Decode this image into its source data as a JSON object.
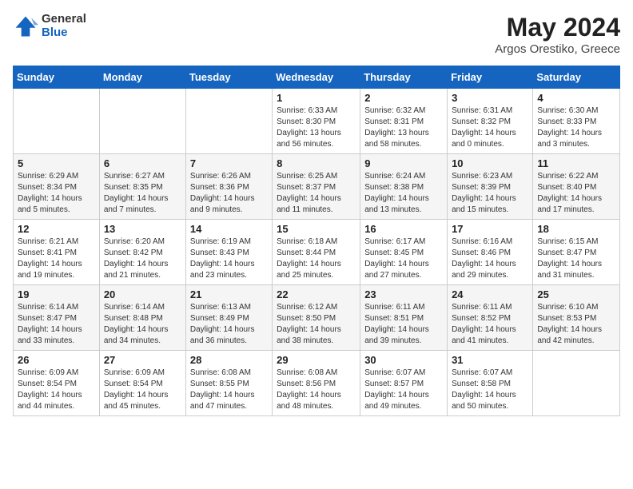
{
  "header": {
    "logo_general": "General",
    "logo_blue": "Blue",
    "month_title": "May 2024",
    "location": "Argos Orestiko, Greece"
  },
  "days_of_week": [
    "Sunday",
    "Monday",
    "Tuesday",
    "Wednesday",
    "Thursday",
    "Friday",
    "Saturday"
  ],
  "weeks": [
    [
      {
        "day": "",
        "info": ""
      },
      {
        "day": "",
        "info": ""
      },
      {
        "day": "",
        "info": ""
      },
      {
        "day": "1",
        "info": "Sunrise: 6:33 AM\nSunset: 8:30 PM\nDaylight: 13 hours\nand 56 minutes."
      },
      {
        "day": "2",
        "info": "Sunrise: 6:32 AM\nSunset: 8:31 PM\nDaylight: 13 hours\nand 58 minutes."
      },
      {
        "day": "3",
        "info": "Sunrise: 6:31 AM\nSunset: 8:32 PM\nDaylight: 14 hours\nand 0 minutes."
      },
      {
        "day": "4",
        "info": "Sunrise: 6:30 AM\nSunset: 8:33 PM\nDaylight: 14 hours\nand 3 minutes."
      }
    ],
    [
      {
        "day": "5",
        "info": "Sunrise: 6:29 AM\nSunset: 8:34 PM\nDaylight: 14 hours\nand 5 minutes."
      },
      {
        "day": "6",
        "info": "Sunrise: 6:27 AM\nSunset: 8:35 PM\nDaylight: 14 hours\nand 7 minutes."
      },
      {
        "day": "7",
        "info": "Sunrise: 6:26 AM\nSunset: 8:36 PM\nDaylight: 14 hours\nand 9 minutes."
      },
      {
        "day": "8",
        "info": "Sunrise: 6:25 AM\nSunset: 8:37 PM\nDaylight: 14 hours\nand 11 minutes."
      },
      {
        "day": "9",
        "info": "Sunrise: 6:24 AM\nSunset: 8:38 PM\nDaylight: 14 hours\nand 13 minutes."
      },
      {
        "day": "10",
        "info": "Sunrise: 6:23 AM\nSunset: 8:39 PM\nDaylight: 14 hours\nand 15 minutes."
      },
      {
        "day": "11",
        "info": "Sunrise: 6:22 AM\nSunset: 8:40 PM\nDaylight: 14 hours\nand 17 minutes."
      }
    ],
    [
      {
        "day": "12",
        "info": "Sunrise: 6:21 AM\nSunset: 8:41 PM\nDaylight: 14 hours\nand 19 minutes."
      },
      {
        "day": "13",
        "info": "Sunrise: 6:20 AM\nSunset: 8:42 PM\nDaylight: 14 hours\nand 21 minutes."
      },
      {
        "day": "14",
        "info": "Sunrise: 6:19 AM\nSunset: 8:43 PM\nDaylight: 14 hours\nand 23 minutes."
      },
      {
        "day": "15",
        "info": "Sunrise: 6:18 AM\nSunset: 8:44 PM\nDaylight: 14 hours\nand 25 minutes."
      },
      {
        "day": "16",
        "info": "Sunrise: 6:17 AM\nSunset: 8:45 PM\nDaylight: 14 hours\nand 27 minutes."
      },
      {
        "day": "17",
        "info": "Sunrise: 6:16 AM\nSunset: 8:46 PM\nDaylight: 14 hours\nand 29 minutes."
      },
      {
        "day": "18",
        "info": "Sunrise: 6:15 AM\nSunset: 8:47 PM\nDaylight: 14 hours\nand 31 minutes."
      }
    ],
    [
      {
        "day": "19",
        "info": "Sunrise: 6:14 AM\nSunset: 8:47 PM\nDaylight: 14 hours\nand 33 minutes."
      },
      {
        "day": "20",
        "info": "Sunrise: 6:14 AM\nSunset: 8:48 PM\nDaylight: 14 hours\nand 34 minutes."
      },
      {
        "day": "21",
        "info": "Sunrise: 6:13 AM\nSunset: 8:49 PM\nDaylight: 14 hours\nand 36 minutes."
      },
      {
        "day": "22",
        "info": "Sunrise: 6:12 AM\nSunset: 8:50 PM\nDaylight: 14 hours\nand 38 minutes."
      },
      {
        "day": "23",
        "info": "Sunrise: 6:11 AM\nSunset: 8:51 PM\nDaylight: 14 hours\nand 39 minutes."
      },
      {
        "day": "24",
        "info": "Sunrise: 6:11 AM\nSunset: 8:52 PM\nDaylight: 14 hours\nand 41 minutes."
      },
      {
        "day": "25",
        "info": "Sunrise: 6:10 AM\nSunset: 8:53 PM\nDaylight: 14 hours\nand 42 minutes."
      }
    ],
    [
      {
        "day": "26",
        "info": "Sunrise: 6:09 AM\nSunset: 8:54 PM\nDaylight: 14 hours\nand 44 minutes."
      },
      {
        "day": "27",
        "info": "Sunrise: 6:09 AM\nSunset: 8:54 PM\nDaylight: 14 hours\nand 45 minutes."
      },
      {
        "day": "28",
        "info": "Sunrise: 6:08 AM\nSunset: 8:55 PM\nDaylight: 14 hours\nand 47 minutes."
      },
      {
        "day": "29",
        "info": "Sunrise: 6:08 AM\nSunset: 8:56 PM\nDaylight: 14 hours\nand 48 minutes."
      },
      {
        "day": "30",
        "info": "Sunrise: 6:07 AM\nSunset: 8:57 PM\nDaylight: 14 hours\nand 49 minutes."
      },
      {
        "day": "31",
        "info": "Sunrise: 6:07 AM\nSunset: 8:58 PM\nDaylight: 14 hours\nand 50 minutes."
      },
      {
        "day": "",
        "info": ""
      }
    ]
  ]
}
